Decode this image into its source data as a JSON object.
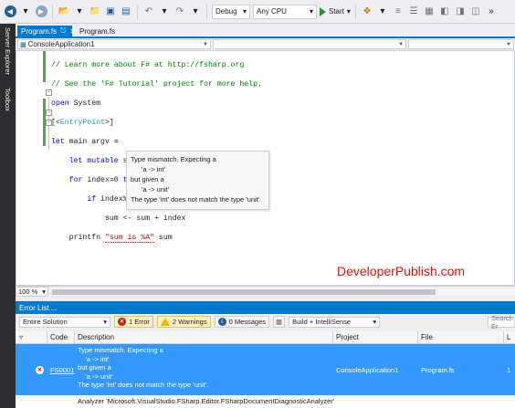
{
  "toolbar": {
    "config": "Debug",
    "platform": "Any CPU",
    "start_label": "Start"
  },
  "rail": {
    "server_explorer": "Server Explorer",
    "toolbox": "Toolbox"
  },
  "tabs": [
    {
      "label": "Program.fs",
      "active": true
    },
    {
      "label": "Program.fs",
      "active": false
    }
  ],
  "navbar": {
    "scope": "ConsoleApplication1"
  },
  "editor": {
    "lines": [
      "// Learn more about F# at http://fsharp.org",
      "// See the 'F# Tutorial' project for more help.",
      "open System",
      "[<EntryPoint>]",
      "let main argv =",
      "    let mutable sum = 0",
      "    for index=0 to 100 do",
      "        if index%2 <> 0 then",
      "            sum <- sum + index",
      "    printfn \"sum is %A\" sum"
    ],
    "zoom": "100 %"
  },
  "tooltip": {
    "line1": "Type mismatch. Expecting a",
    "line2": "'a -> int'",
    "line3": "but given a",
    "line4": "'a -> unit'",
    "line5": "The type 'int' does not match the type 'unit'"
  },
  "watermark": "DeveloperPublish.com",
  "error_list": {
    "title": "Error List ...",
    "scope": "Entire Solution",
    "errors_label": "1 Error",
    "warnings_label": "2 Warnings",
    "messages_label": "0 Messages",
    "build_filter": "Build + IntelliSense",
    "search_placeholder": "Search Er",
    "columns": {
      "code": "Code",
      "description": "Description",
      "project": "Project",
      "file": "File",
      "line": "L"
    },
    "rows": [
      {
        "code": "FS0001",
        "description": "Type mismatch. Expecting a\n    'a -> int'\nbut given a\n    'a -> unit'\nThe type 'int' does not match the type 'unit'.",
        "project": "ConsoleApplication1",
        "file": "Program.fs",
        "line": "1"
      },
      {
        "description": "Analyzer 'Microsoft.VisualStudio.FSharp.Editor.FSharpDocumentDiagnosticAnalyzer'"
      }
    ]
  }
}
